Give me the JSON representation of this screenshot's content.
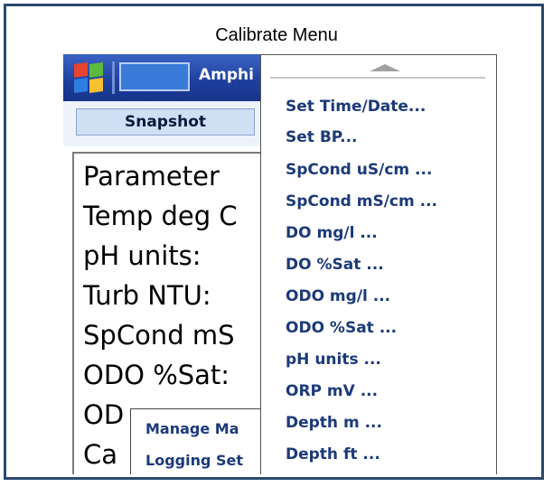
{
  "caption": "Calibrate Menu",
  "taskbar": {
    "title": "Amphi"
  },
  "toolbar": {
    "snapshot_label": "Snapshot"
  },
  "table": {
    "rows": [
      "Parameter",
      "Temp deg C",
      "pH units:",
      "Turb NTU:",
      "SpCond mS",
      "ODO %Sat:",
      "OD",
      "Ca"
    ]
  },
  "submenu": {
    "items": [
      "Manage Ma",
      "Logging Set"
    ]
  },
  "calibrate_menu": {
    "items": [
      "Set Time/Date...",
      "Set BP...",
      "SpCond uS/cm ...",
      "SpCond mS/cm ...",
      "DO mg/l ...",
      "DO %Sat ...",
      "ODO mg/l ...",
      "ODO %Sat ...",
      "pH units ...",
      "ORP mV ...",
      "Depth m ...",
      "Depth ft ..."
    ]
  },
  "colors": {
    "frame": "#2c4870",
    "menu_text": "#1c3a7a",
    "taskbar": "#1d3f9c"
  },
  "icons": {
    "start": "windows-logo-icon",
    "scroll": "scroll-up-arrow-icon"
  }
}
